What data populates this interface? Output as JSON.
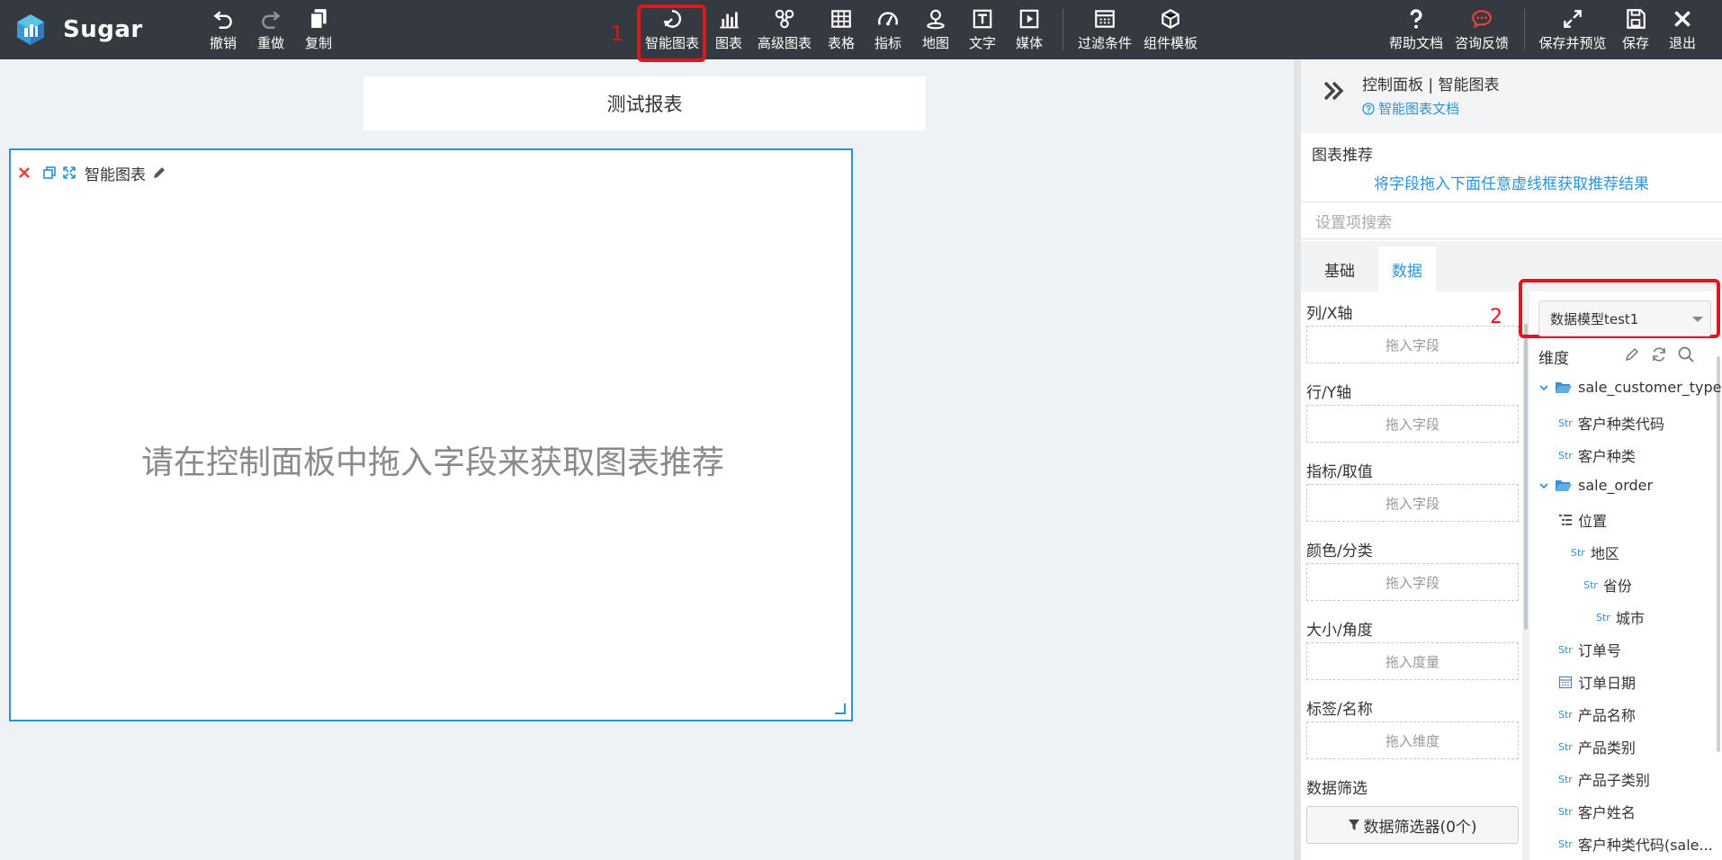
{
  "app": {
    "name": "Sugar"
  },
  "toolbar": {
    "undo": "撤销",
    "redo": "重做",
    "copy": "复制",
    "smart_chart": "智能图表",
    "chart": "图表",
    "advanced_chart": "高级图表",
    "table": "表格",
    "metric": "指标",
    "map": "地图",
    "text": "文字",
    "media": "媒体",
    "filter": "过滤条件",
    "component_template": "组件模板",
    "help_doc": "帮助文档",
    "feedback": "咨询反馈",
    "save_preview": "保存并预览",
    "save": "保存",
    "exit": "退出"
  },
  "annotations": {
    "first": "1",
    "second": "2"
  },
  "canvas": {
    "report_title": "测试报表",
    "card_title": "智能图表",
    "card_hint": "请在控制面板中拖入字段来获取图表推荐"
  },
  "panel": {
    "breadcrumb": "控制面板 | 智能图表",
    "doc_link": "智能图表文档",
    "recommend_label": "图表推荐",
    "recommend_hint": "将字段拖入下面任意虚线框获取推荐结果",
    "search_placeholder": "设置项搜索",
    "tabs": {
      "basic": "基础",
      "data": "数据"
    },
    "fields": [
      {
        "label": "列/X轴",
        "zone": "拖入字段"
      },
      {
        "label": "行/Y轴",
        "zone": "拖入字段"
      },
      {
        "label": "指标/取值",
        "zone": "拖入字段"
      },
      {
        "label": "颜色/分类",
        "zone": "拖入字段"
      },
      {
        "label": "大小/角度",
        "zone": "拖入度量"
      },
      {
        "label": "标签/名称",
        "zone": "拖入维度"
      }
    ],
    "data_filter_label": "数据筛选",
    "data_filter_button": "数据筛选器(0个)",
    "model_select": "数据模型test1",
    "dimension_title": "维度",
    "str_tag": "Str",
    "tree": {
      "group1": "sale_customer_type",
      "g1_items": [
        "客户种类代码",
        "客户种类"
      ],
      "group2": "sale_order",
      "hierarchy": "位置",
      "region": "地区",
      "province": "省份",
      "city": "城市",
      "order_no": "订单号",
      "order_date": "订单日期",
      "rest": [
        "产品名称",
        "产品类别",
        "产品子类别",
        "客户姓名",
        "客户种类代码(sale..."
      ]
    }
  }
}
